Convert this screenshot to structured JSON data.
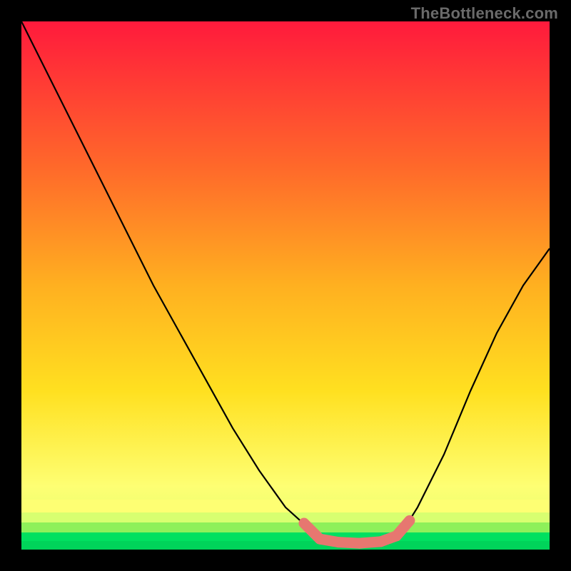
{
  "watermark": "TheBottleneck.com",
  "colors": {
    "black": "#000000",
    "top_red": "#ff1a3c",
    "deep_orange": "#ff6a2a",
    "orange": "#ffb020",
    "yellow": "#ffe020",
    "light_yellow": "#feff73",
    "pale_green": "#d8ff70",
    "lime": "#8ef05a",
    "green": "#00e060",
    "curve": "#000000",
    "overlay_pink": "#e77770"
  },
  "chart_data": {
    "type": "line",
    "title": "",
    "x": [
      0.0,
      0.05,
      0.1,
      0.15,
      0.2,
      0.25,
      0.3,
      0.35,
      0.4,
      0.45,
      0.5,
      0.55,
      0.575,
      0.6,
      0.625,
      0.65,
      0.675,
      0.7,
      0.725,
      0.75,
      0.8,
      0.85,
      0.9,
      0.95,
      1.0
    ],
    "values": [
      1.0,
      0.9,
      0.8,
      0.7,
      0.6,
      0.5,
      0.41,
      0.32,
      0.23,
      0.15,
      0.08,
      0.035,
      0.02,
      0.012,
      0.01,
      0.01,
      0.012,
      0.02,
      0.04,
      0.08,
      0.18,
      0.3,
      0.41,
      0.5,
      0.57
    ],
    "minimum_region_x": [
      0.55,
      0.72
    ],
    "overlay_segments": [
      {
        "x0": 0.535,
        "y0": 0.05,
        "x1": 0.565,
        "y1": 0.02
      },
      {
        "x0": 0.565,
        "y0": 0.02,
        "x1": 0.6,
        "y1": 0.014
      },
      {
        "x0": 0.6,
        "y0": 0.014,
        "x1": 0.64,
        "y1": 0.012
      },
      {
        "x0": 0.64,
        "y0": 0.012,
        "x1": 0.68,
        "y1": 0.015
      },
      {
        "x0": 0.68,
        "y0": 0.015,
        "x1": 0.71,
        "y1": 0.026
      },
      {
        "x0": 0.71,
        "y0": 0.026,
        "x1": 0.735,
        "y1": 0.055
      }
    ],
    "xlabel": "",
    "ylabel": "",
    "xlim": [
      0,
      1
    ],
    "ylim": [
      0,
      1
    ],
    "grid": false,
    "legend": false
  }
}
